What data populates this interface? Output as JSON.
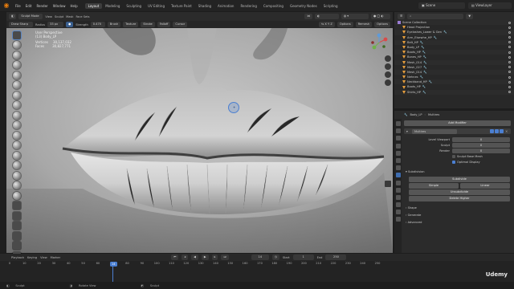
{
  "menubar": {
    "menus": [
      "File",
      "Edit",
      "Render",
      "Window",
      "Help"
    ],
    "workspaces": [
      "Layout",
      "Modeling",
      "Sculpting",
      "UV Editing",
      "Texture Paint",
      "Shading",
      "Animation",
      "Rendering",
      "Compositing",
      "Geometry Nodes",
      "Scripting"
    ],
    "active_workspace": "Layout",
    "scene_label": "Scene",
    "viewlayer_label": "ViewLayer"
  },
  "viewport_header": {
    "mode": "Sculpt Mode",
    "view": "View",
    "sculpt": "Sculpt",
    "mask": "Mask",
    "face_sets": "Face Sets",
    "brush_name": "Draw Sharp",
    "radius_label": "Radius",
    "radius_value": "33 px",
    "strength_label": "Strength",
    "strength_value": "0.470",
    "brush_menu": "Brush",
    "texture_menu": "Texture",
    "stroke_menu": "Stroke",
    "falloff_menu": "Falloff",
    "cursor_menu": "Cursor",
    "options_menu": "Options",
    "remesh_menu": "Remesh",
    "options_label": "Options"
  },
  "viewport_info": {
    "line1": "User Perspective",
    "line2": "(13) Body_LP",
    "vertices_label": "Vertices",
    "vertices_value": "30,137,032",
    "faces_label": "Faces",
    "faces_value": "30,827,771"
  },
  "outliner": {
    "rows": [
      {
        "name": "Scene Collection",
        "icon": "collection",
        "mod": ""
      },
      {
        "name": "Head Projection",
        "icon": "mesh",
        "mod": ""
      },
      {
        "name": "Eyelashes_Lower & Gen",
        "icon": "mesh",
        "mod": "modifier"
      },
      {
        "name": "Arm_Elsewhe_HP",
        "icon": "mesh",
        "mod": "modifier"
      },
      {
        "name": "Belt_HP",
        "icon": "mesh",
        "mod": "modifier"
      },
      {
        "name": "Body_LP",
        "icon": "mesh",
        "mod": "modifier"
      },
      {
        "name": "Boots_HP",
        "icon": "mesh",
        "mod": "modifier"
      },
      {
        "name": "Bones_HP",
        "icon": "mesh",
        "mod": "modifier"
      },
      {
        "name": "Mesh_014",
        "icon": "mesh",
        "mod": "modifier"
      },
      {
        "name": "Mesh_027",
        "icon": "mesh",
        "mod": "modifier"
      },
      {
        "name": "Mesh_014",
        "icon": "mesh",
        "mod": "modifier"
      },
      {
        "name": "Nehnes",
        "icon": "mesh",
        "mod": "modifier"
      },
      {
        "name": "Neckband_HP",
        "icon": "mesh",
        "mod": "modifier"
      },
      {
        "name": "Boots_HP",
        "icon": "mesh",
        "mod": "modifier"
      },
      {
        "name": "Shirts_HP",
        "icon": "mesh",
        "mod": "modifier"
      }
    ]
  },
  "properties": {
    "breadcrumb_object": "Body_LP",
    "breadcrumb_modifier": "Multires",
    "add_modifier": "Add Modifier",
    "modifier_name": "Multires",
    "level_viewport_label": "Level Viewport",
    "level_viewport_value": "0",
    "sculpt_label": "Sculpt",
    "sculpt_value": "0",
    "render_label": "Render",
    "render_value": "0",
    "sculpt_base_mesh": "Sculpt Base Mesh",
    "optimal_display": "Optimal Display",
    "subdivision_section": "Subdivision",
    "subdivide_btn": "Subdivide",
    "simple_btn": "Simple",
    "linear_btn": "Linear",
    "unsubdivide_btn": "Unsubdivide",
    "delete_higher_btn": "Delete Higher",
    "shape_section": "Shape",
    "generate_section": "Generate",
    "advanced_section": "Advanced"
  },
  "timeline": {
    "playback": "Playback",
    "keying": "Keying",
    "view": "View",
    "marker": "Marker",
    "current_frame": "14",
    "start_label": "Start",
    "start_value": "1",
    "end_label": "End",
    "end_value": "250",
    "ticks": [
      "0",
      "10",
      "20",
      "30",
      "40",
      "50",
      "60",
      "70",
      "80",
      "90",
      "100",
      "110",
      "120",
      "130",
      "140",
      "150",
      "160",
      "170",
      "180",
      "190",
      "200",
      "210",
      "220",
      "230",
      "240",
      "250"
    ]
  },
  "statusbar": {
    "left": "Sculpt",
    "middle": "Rotate View",
    "right": "Sculpt",
    "watermark": "Udemy"
  },
  "colors": {
    "accent": "#4b7fd1",
    "blender_orange": "#e87d0d"
  }
}
